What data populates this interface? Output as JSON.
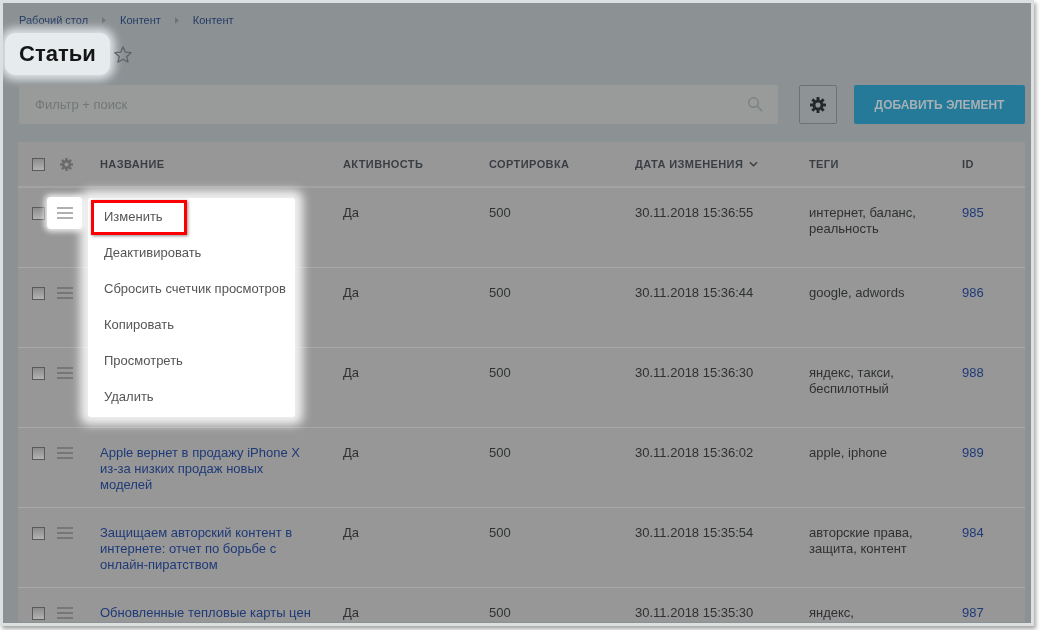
{
  "breadcrumbs": [
    {
      "label": "Рабочий стол"
    },
    {
      "label": "Контент"
    },
    {
      "label": "Контент"
    }
  ],
  "page": {
    "title": "Статьи",
    "favorite": false
  },
  "toolbar": {
    "filter": {
      "placeholder": "Фильтр + поиск"
    },
    "add_button": "ДОБАВИТЬ ЭЛЕМЕНТ"
  },
  "table": {
    "select_all_checked": false,
    "columns": [
      {
        "label": "НАЗВАНИЕ",
        "sorted": false
      },
      {
        "label": "АКТИВНОСТЬ",
        "sorted": false
      },
      {
        "label": "СОРТИРОВКА",
        "sorted": false
      },
      {
        "label": "ДАТА ИЗМЕНЕНИЯ",
        "sorted": true
      },
      {
        "label": "ТЕГИ",
        "sorted": false
      },
      {
        "label": "ID",
        "sorted": false
      }
    ],
    "rows": [
      {
        "checked": false,
        "menu_open": true,
        "active": "Да",
        "sort": "500",
        "modified": "30.11.2018 15:36:55",
        "tags": "интернет, баланс, реальность",
        "id": "985"
      },
      {
        "checked": false,
        "menu_open": false,
        "active": "Да",
        "sort": "500",
        "modified": "30.11.2018 15:36:44",
        "tags": "google, adwords",
        "id": "986"
      },
      {
        "checked": false,
        "menu_open": false,
        "active": "Да",
        "sort": "500",
        "modified": "30.11.2018 15:36:30",
        "tags": "яндекс, такси, беспилотный",
        "id": "988"
      },
      {
        "checked": false,
        "menu_open": false,
        "name": "Apple вернет в продажу iPhone X из-за низких продаж новых моделей",
        "active": "Да",
        "sort": "500",
        "modified": "30.11.2018 15:36:02",
        "tags": "apple, iphone",
        "id": "989"
      },
      {
        "checked": false,
        "menu_open": false,
        "name": "Защищаем авторский контент в интернете: отчет по борьбе с онлайн-пиратством",
        "active": "Да",
        "sort": "500",
        "modified": "30.11.2018 15:35:54",
        "tags": "авторские права, защита, контент",
        "id": "984"
      },
      {
        "checked": false,
        "menu_open": false,
        "name": "Обновленные тепловые карты цен",
        "active": "Да",
        "sort": "500",
        "modified": "30.11.2018 15:35:30",
        "tags": "яндекс,",
        "id": "987"
      }
    ]
  },
  "context_menu": {
    "items": [
      {
        "label": "Изменить",
        "highlighted": true
      },
      {
        "label": "Деактивировать",
        "highlighted": false
      },
      {
        "label": "Сбросить счетчик просмотров",
        "highlighted": false
      },
      {
        "label": "Копировать",
        "highlighted": false
      },
      {
        "label": "Просмотреть",
        "highlighted": false
      },
      {
        "label": "Удалить",
        "highlighted": false
      }
    ]
  }
}
